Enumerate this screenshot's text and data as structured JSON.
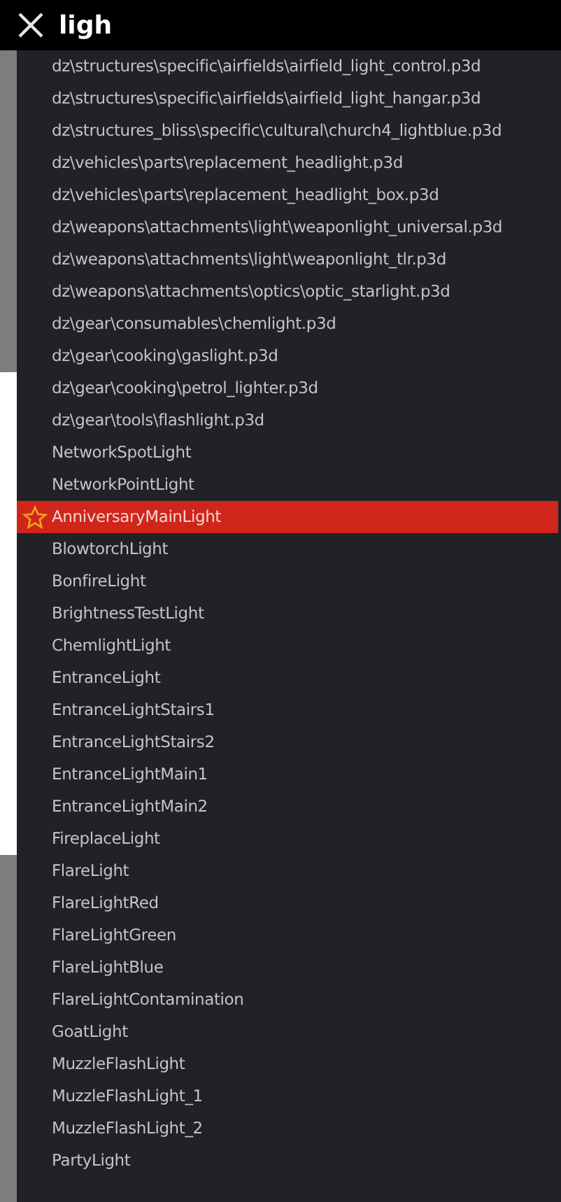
{
  "search": {
    "value": "ligh"
  },
  "results": [
    {
      "label": "dz\\structures\\specific\\airfields\\airfield_light_control.p3d",
      "selected": false,
      "starred": false
    },
    {
      "label": "dz\\structures\\specific\\airfields\\airfield_light_hangar.p3d",
      "selected": false,
      "starred": false
    },
    {
      "label": "dz\\structures_bliss\\specific\\cultural\\church4_lightblue.p3d",
      "selected": false,
      "starred": false
    },
    {
      "label": "dz\\vehicles\\parts\\replacement_headlight.p3d",
      "selected": false,
      "starred": false
    },
    {
      "label": "dz\\vehicles\\parts\\replacement_headlight_box.p3d",
      "selected": false,
      "starred": false
    },
    {
      "label": "dz\\weapons\\attachments\\light\\weaponlight_universal.p3d",
      "selected": false,
      "starred": false
    },
    {
      "label": "dz\\weapons\\attachments\\light\\weaponlight_tlr.p3d",
      "selected": false,
      "starred": false
    },
    {
      "label": "dz\\weapons\\attachments\\optics\\optic_starlight.p3d",
      "selected": false,
      "starred": false
    },
    {
      "label": "dz\\gear\\consumables\\chemlight.p3d",
      "selected": false,
      "starred": false
    },
    {
      "label": "dz\\gear\\cooking\\gaslight.p3d",
      "selected": false,
      "starred": false
    },
    {
      "label": "dz\\gear\\cooking\\petrol_lighter.p3d",
      "selected": false,
      "starred": false
    },
    {
      "label": "dz\\gear\\tools\\flashlight.p3d",
      "selected": false,
      "starred": false
    },
    {
      "label": "NetworkSpotLight",
      "selected": false,
      "starred": false
    },
    {
      "label": "NetworkPointLight",
      "selected": false,
      "starred": false
    },
    {
      "label": "AnniversaryMainLight",
      "selected": true,
      "starred": true
    },
    {
      "label": "BlowtorchLight",
      "selected": false,
      "starred": false
    },
    {
      "label": "BonfireLight",
      "selected": false,
      "starred": false
    },
    {
      "label": "BrightnessTestLight",
      "selected": false,
      "starred": false
    },
    {
      "label": "ChemlightLight",
      "selected": false,
      "starred": false
    },
    {
      "label": "EntranceLight",
      "selected": false,
      "starred": false
    },
    {
      "label": "EntranceLightStairs1",
      "selected": false,
      "starred": false
    },
    {
      "label": "EntranceLightStairs2",
      "selected": false,
      "starred": false
    },
    {
      "label": "EntranceLightMain1",
      "selected": false,
      "starred": false
    },
    {
      "label": "EntranceLightMain2",
      "selected": false,
      "starred": false
    },
    {
      "label": "FireplaceLight",
      "selected": false,
      "starred": false
    },
    {
      "label": "FlareLight",
      "selected": false,
      "starred": false
    },
    {
      "label": "FlareLightRed",
      "selected": false,
      "starred": false
    },
    {
      "label": "FlareLightGreen",
      "selected": false,
      "starred": false
    },
    {
      "label": "FlareLightBlue",
      "selected": false,
      "starred": false
    },
    {
      "label": "FlareLightContamination",
      "selected": false,
      "starred": false
    },
    {
      "label": "GoatLight",
      "selected": false,
      "starred": false
    },
    {
      "label": "MuzzleFlashLight",
      "selected": false,
      "starred": false
    },
    {
      "label": "MuzzleFlashLight_1",
      "selected": false,
      "starred": false
    },
    {
      "label": "MuzzleFlashLight_2",
      "selected": false,
      "starred": false
    },
    {
      "label": "PartyLight",
      "selected": false,
      "starred": false
    }
  ]
}
